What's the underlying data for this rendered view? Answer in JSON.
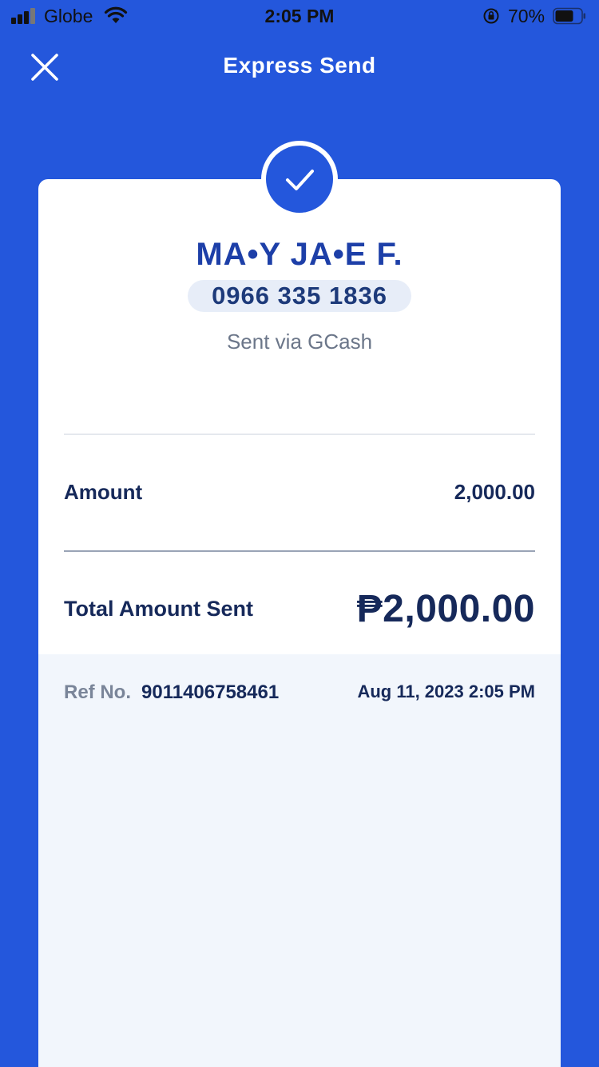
{
  "status_bar": {
    "carrier": "Globe",
    "time": "2:05 PM",
    "battery_percent": "70%"
  },
  "header": {
    "title": "Express Send",
    "close_icon": "close-icon"
  },
  "receipt": {
    "status_icon": "check-icon",
    "recipient_name": "MA•Y JA•E F.",
    "recipient_number": "0966 335 1836",
    "method": "Sent via GCash",
    "amount_label": "Amount",
    "amount_value": "2,000.00",
    "total_label": "Total Amount Sent",
    "total_value": "₱2,000.00",
    "ref_label": "Ref No.",
    "ref_number": "9011406758461",
    "datetime": "Aug 11, 2023 2:05 PM"
  },
  "colors": {
    "brand_blue": "#2457DC",
    "name_blue": "#1D3FA8",
    "dark_text": "#16295A",
    "muted_text": "#6B7689",
    "footer_bg": "#F2F6FC"
  }
}
